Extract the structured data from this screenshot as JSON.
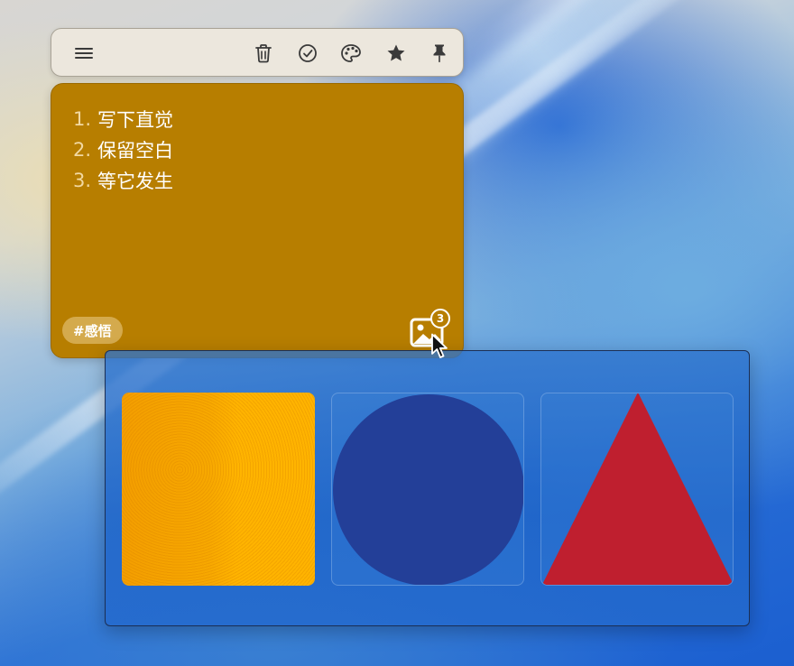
{
  "toolbar": {
    "menu_icon": "hamburger-menu-icon",
    "delete_icon": "trash-icon",
    "done_icon": "check-circle-icon",
    "color_icon": "palette-icon",
    "favorite_icon": "star-icon",
    "pin_icon": "pin-icon"
  },
  "note": {
    "background_color": "#b77e00",
    "items": [
      {
        "num": "1.",
        "text": "写下直觉"
      },
      {
        "num": "2.",
        "text": "保留空白"
      },
      {
        "num": "3.",
        "text": "等它发生"
      }
    ],
    "tag": "#感悟",
    "image_count": "3"
  },
  "gallery": {
    "images": [
      {
        "shape": "square",
        "color": "#ffb400"
      },
      {
        "shape": "circle",
        "color": "#233f98"
      },
      {
        "shape": "triangle",
        "color": "#bf1f2f"
      }
    ]
  }
}
